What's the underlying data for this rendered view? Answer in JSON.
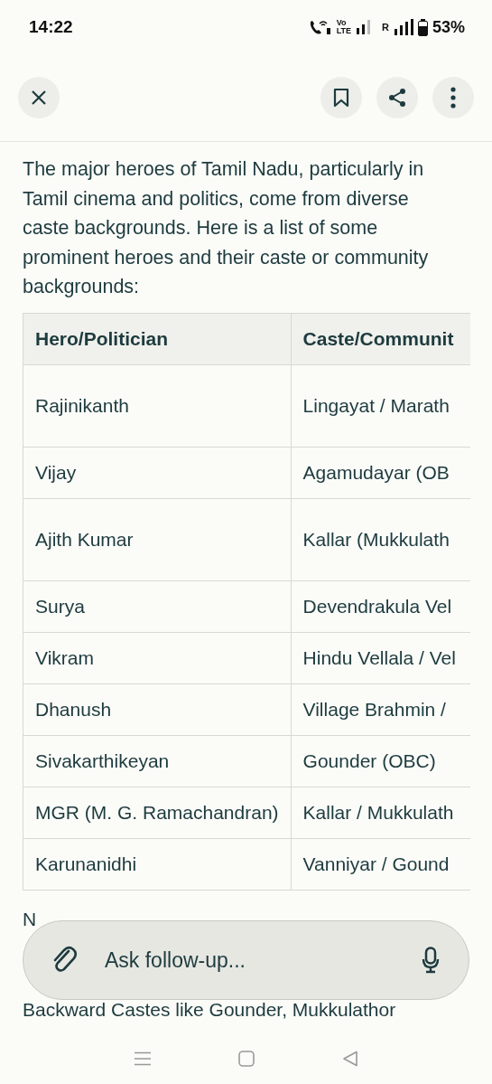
{
  "status_bar": {
    "time": "14:22",
    "volte_top": "Vo",
    "volte_bottom": "LTE",
    "roaming": "R",
    "battery": "53%"
  },
  "intro": "The major heroes of Tamil Nadu, particularly in Tamil cinema and politics, come from diverse caste backgrounds. Here is a list of some prominent heroes and their caste or community backgrounds:",
  "table": {
    "columns": [
      "Hero/Politician",
      "Caste/Communit"
    ],
    "rows": [
      {
        "cells": [
          "Rajinikanth",
          "Lingayat / Marath"
        ]
      },
      {
        "cells": [
          "Vijay",
          "Agamudayar (OB"
        ]
      },
      {
        "cells": [
          "Ajith Kumar",
          "Kallar (Mukkulath"
        ]
      },
      {
        "cells": [
          "Surya",
          "Devendrakula Vel"
        ]
      },
      {
        "cells": [
          "Vikram",
          "Hindu Vellala / Vel"
        ]
      },
      {
        "cells": [
          "Dhanush",
          "Village Brahmin /"
        ]
      },
      {
        "cells": [
          "Sivakarthikeyan",
          "Gounder (OBC)"
        ]
      },
      {
        "cells": [
          "MGR (M. G. Ramachandran)",
          "Kallar / Mukkulath"
        ]
      },
      {
        "cells": [
          "Karunanidhi",
          "Vanniyar / Gound"
        ]
      }
    ]
  },
  "note_start": "N",
  "note_cut_line": "Backward Castes like Gounder, Mukkulathor",
  "follow_up": {
    "placeholder": "Ask follow-up..."
  }
}
